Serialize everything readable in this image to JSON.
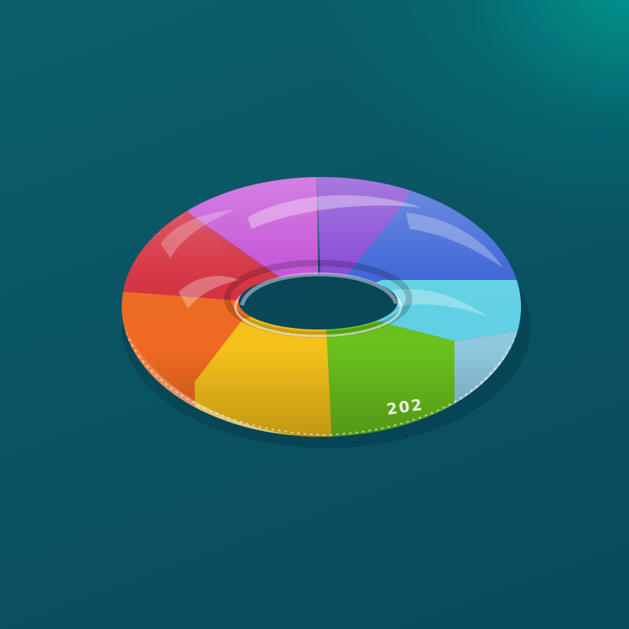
{
  "scene": {
    "subject": "swim-ring-icon",
    "ring_number": "202",
    "background_color": "#0a5464",
    "segment_colors": {
      "red": "#d4303f",
      "magenta": "#c34fd6",
      "violet": "#8446d3",
      "blue": "#3b63d6",
      "cyan": "#62d2e6",
      "pale_blue": "#8fc9e0",
      "orange": "#f06a21",
      "yellow": "#f6c21a",
      "green": "#6bc21d"
    }
  }
}
